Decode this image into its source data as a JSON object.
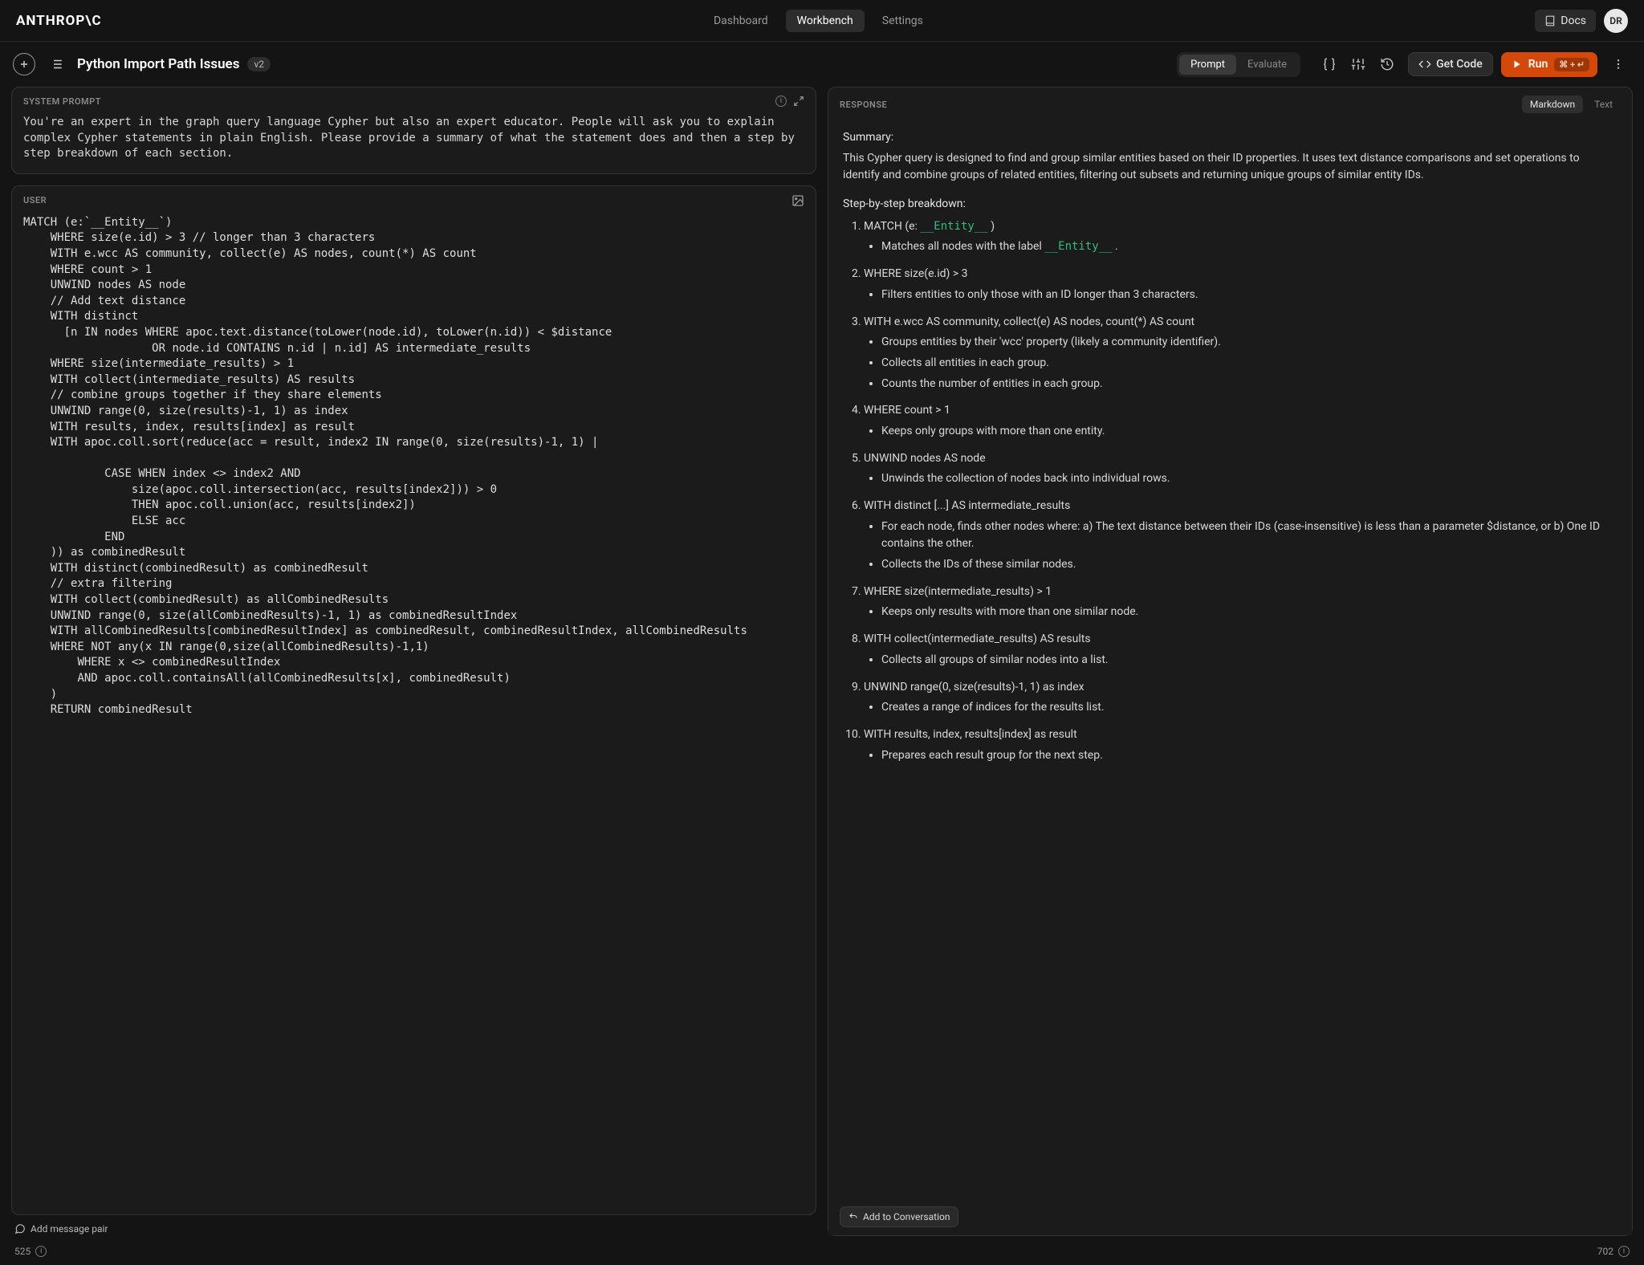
{
  "brand": "ANTHROP\\C",
  "nav": {
    "dashboard": "Dashboard",
    "workbench": "Workbench",
    "settings": "Settings",
    "docs": "Docs"
  },
  "user": {
    "initials": "DR"
  },
  "toolbar": {
    "title": "Python Import Path Issues",
    "version": "v2",
    "prompt": "Prompt",
    "evaluate": "Evaluate",
    "get_code": "Get Code",
    "run": "Run",
    "run_shortcut": "⌘ + ↵"
  },
  "system": {
    "label": "SYSTEM PROMPT",
    "body": "You're an expert in the graph query language Cypher but also an expert educator. People will ask you to explain complex Cypher statements in plain English. Please provide a summary of what the statement does and then a step by step breakdown of each section."
  },
  "userMsg": {
    "label": "USER",
    "body": "MATCH (e:`__Entity__`)\n    WHERE size(e.id) > 3 // longer than 3 characters\n    WITH e.wcc AS community, collect(e) AS nodes, count(*) AS count\n    WHERE count > 1\n    UNWIND nodes AS node\n    // Add text distance\n    WITH distinct\n      [n IN nodes WHERE apoc.text.distance(toLower(node.id), toLower(n.id)) < $distance\n                   OR node.id CONTAINS n.id | n.id] AS intermediate_results\n    WHERE size(intermediate_results) > 1\n    WITH collect(intermediate_results) AS results\n    // combine groups together if they share elements\n    UNWIND range(0, size(results)-1, 1) as index\n    WITH results, index, results[index] as result\n    WITH apoc.coll.sort(reduce(acc = result, index2 IN range(0, size(results)-1, 1) |\n\n            CASE WHEN index <> index2 AND\n                size(apoc.coll.intersection(acc, results[index2])) > 0\n                THEN apoc.coll.union(acc, results[index2])\n                ELSE acc\n            END\n    )) as combinedResult\n    WITH distinct(combinedResult) as combinedResult\n    // extra filtering\n    WITH collect(combinedResult) as allCombinedResults\n    UNWIND range(0, size(allCombinedResults)-1, 1) as combinedResultIndex\n    WITH allCombinedResults[combinedResultIndex] as combinedResult, combinedResultIndex, allCombinedResults\n    WHERE NOT any(x IN range(0,size(allCombinedResults)-1,1)\n        WHERE x <> combinedResultIndex\n        AND apoc.coll.containsAll(allCombinedResults[x], combinedResult)\n    )\n    RETURN combinedResult"
  },
  "response": {
    "label": "RESPONSE",
    "tabs": {
      "markdown": "Markdown",
      "text": "Text"
    },
    "summary_label": "Summary:",
    "summary": "This Cypher query is designed to find and group similar entities based on their ID properties. It uses text distance comparisons and set operations to identify and combine groups of related entities, filtering out subsets and returning unique groups of similar entity IDs.",
    "steps_label": "Step-by-step breakdown:",
    "steps": [
      {
        "head_prefix": "MATCH (e: ",
        "head_lit": "__Entity__",
        "head_suffix": " )",
        "bullets": [
          {
            "pre": "Matches all nodes with the label ",
            "lit": "__Entity__",
            "post": " ."
          }
        ]
      },
      {
        "head": "WHERE size(e.id) > 3",
        "bullets": [
          "Filters entities to only those with an ID longer than 3 characters."
        ]
      },
      {
        "head": "WITH e.wcc AS community, collect(e) AS nodes, count(*) AS count",
        "bullets": [
          "Groups entities by their 'wcc' property (likely a community identifier).",
          "Collects all entities in each group.",
          "Counts the number of entities in each group."
        ]
      },
      {
        "head": "WHERE count > 1",
        "bullets": [
          "Keeps only groups with more than one entity."
        ]
      },
      {
        "head": "UNWIND nodes AS node",
        "bullets": [
          "Unwinds the collection of nodes back into individual rows."
        ]
      },
      {
        "head": "WITH distinct [...] AS intermediate_results",
        "bullets": [
          "For each node, finds other nodes where: a) The text distance between their IDs (case-insensitive) is less than a parameter $distance, or b) One ID contains the other.",
          "Collects the IDs of these similar nodes."
        ]
      },
      {
        "head": "WHERE size(intermediate_results) > 1",
        "bullets": [
          "Keeps only results with more than one similar node."
        ]
      },
      {
        "head": "WITH collect(intermediate_results) AS results",
        "bullets": [
          "Collects all groups of similar nodes into a list."
        ]
      },
      {
        "head": "UNWIND range(0, size(results)-1, 1) as index",
        "bullets": [
          "Creates a range of indices for the results list."
        ]
      },
      {
        "head": "WITH results, index, results[index] as result",
        "bullets": [
          "Prepares each result group for the next step."
        ]
      }
    ],
    "add_to_conversation": "Add to Conversation"
  },
  "footer": {
    "add_pair": "Add message pair",
    "left_count": "525",
    "right_count": "702"
  }
}
